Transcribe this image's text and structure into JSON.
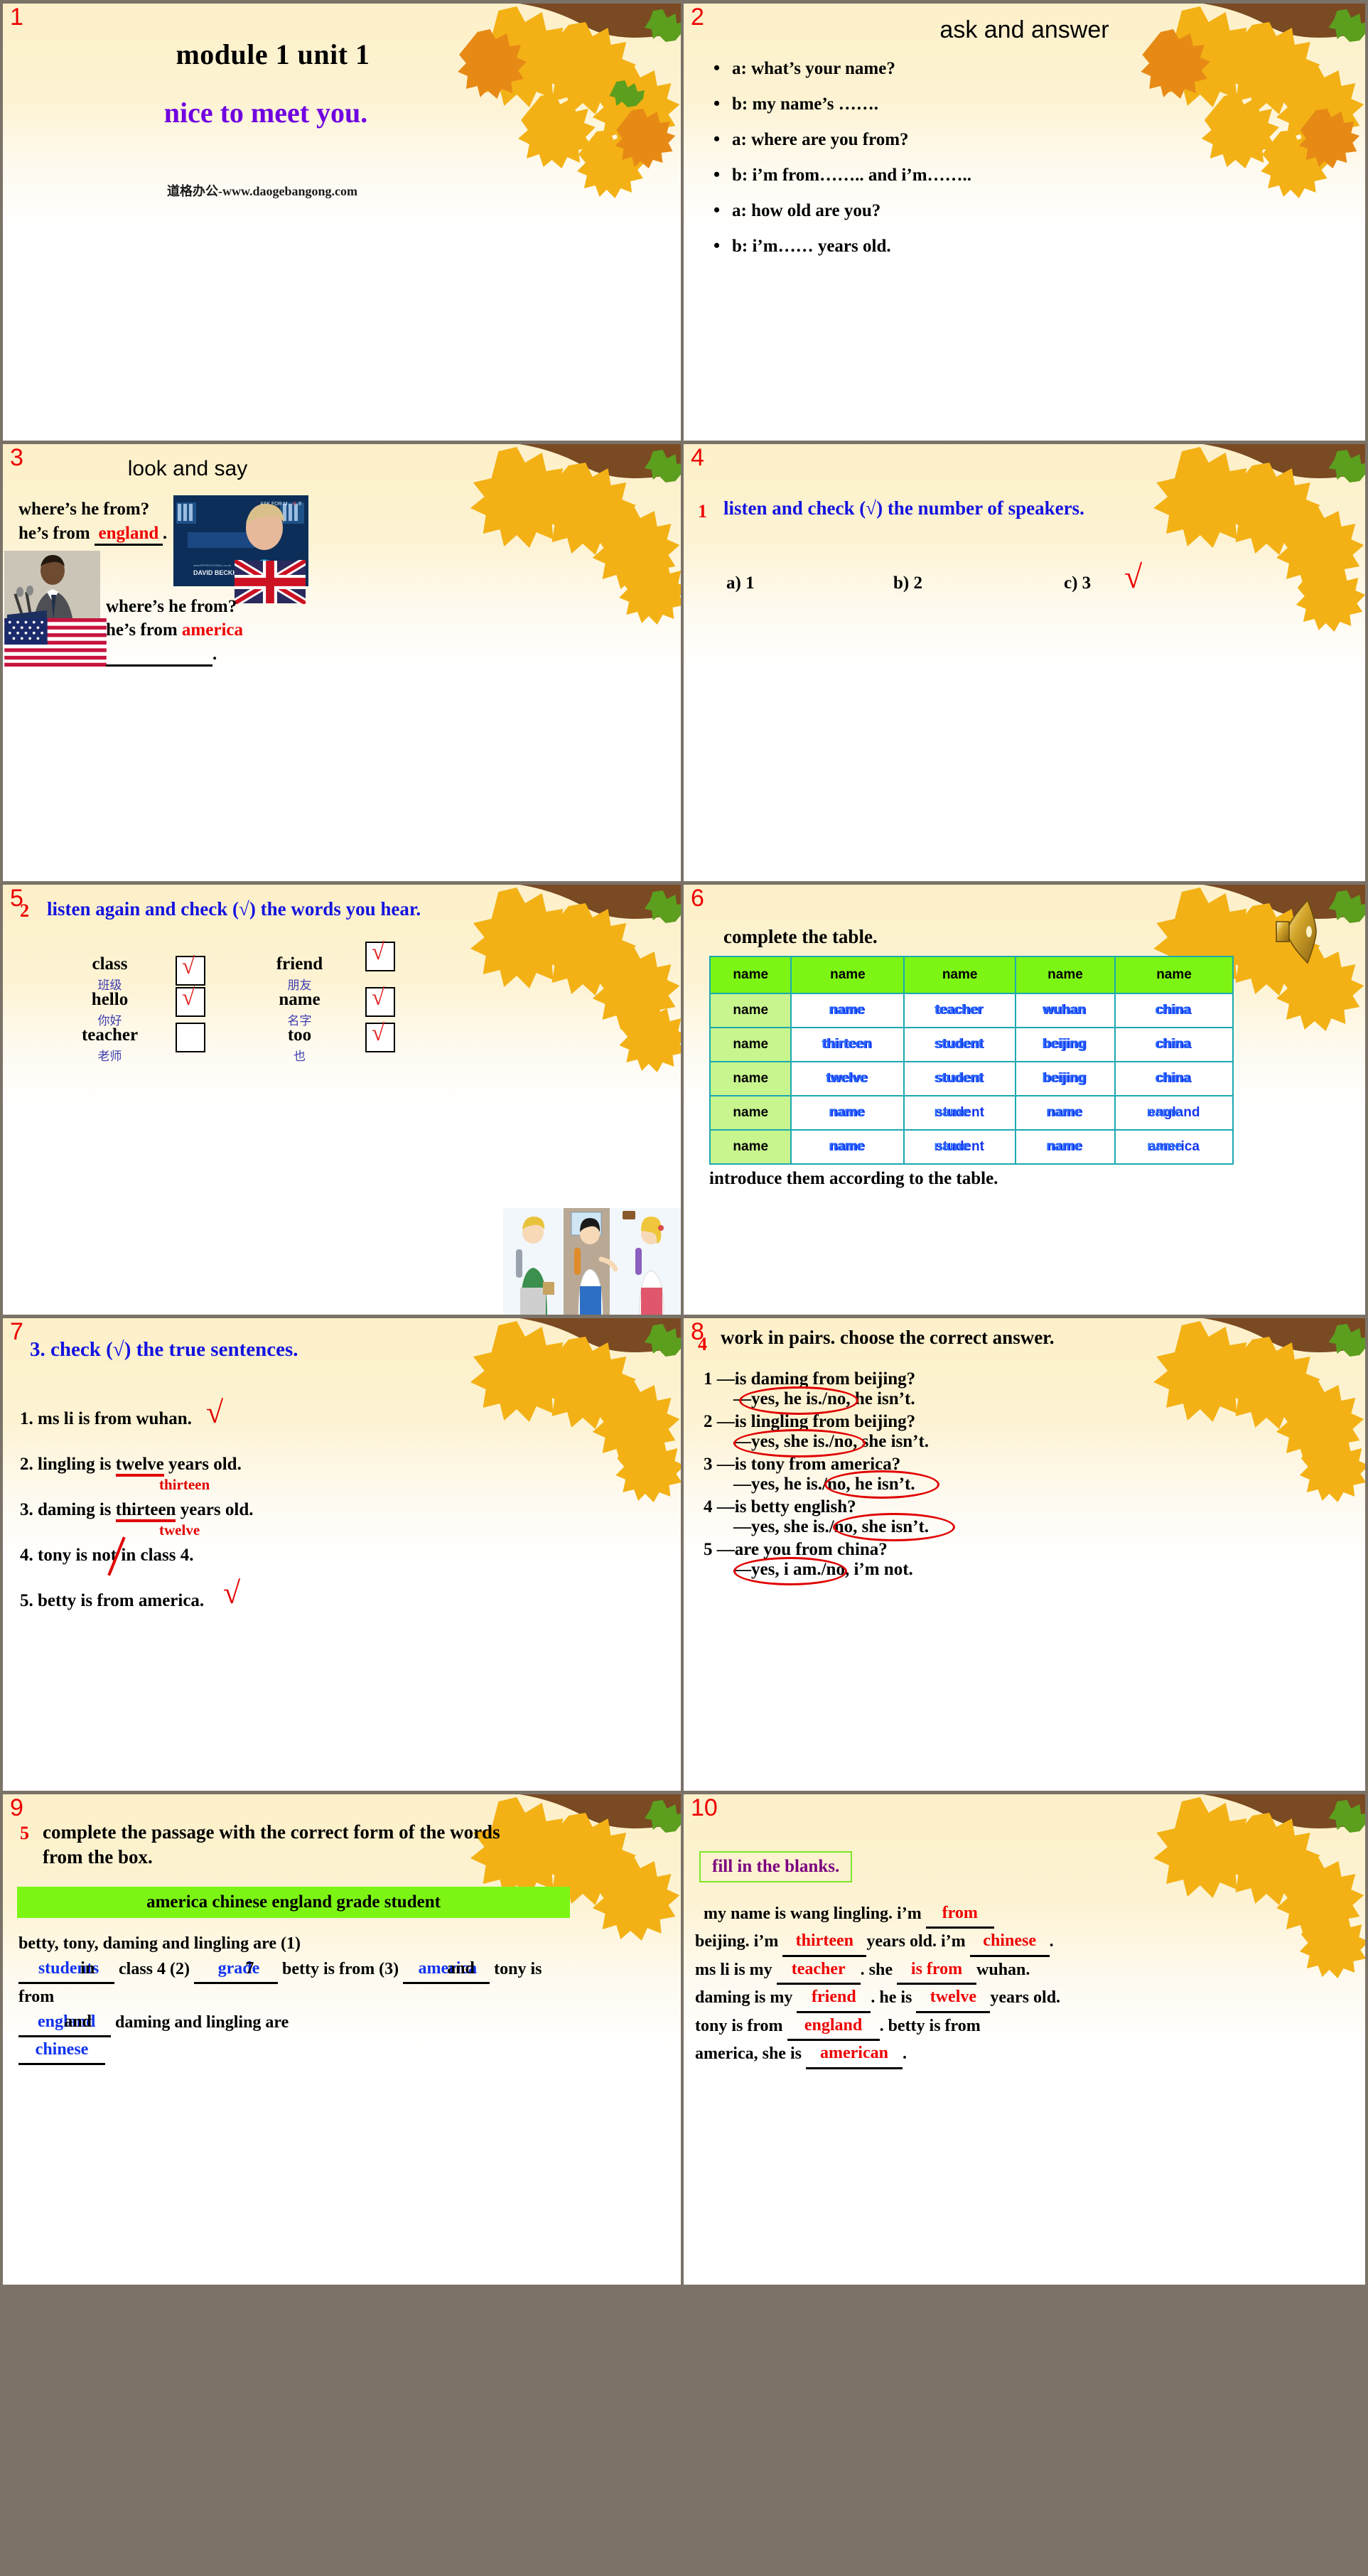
{
  "slides": [
    {
      "num": "1",
      "title": "module 1  unit 1",
      "subtitle": "nice to meet you.",
      "watermark": "道格办公-www.daogebangong.com"
    },
    {
      "num": "2",
      "title": "ask and answer",
      "items": [
        "a: what’s your name?",
        "b: my name’s …….",
        "a: where are you from?",
        "b: i’m from…….. and i’m……..",
        "a: how old are you?",
        "b: i’m…… years old."
      ]
    },
    {
      "num": "3",
      "title": "look and say",
      "q1": "where’s he from?",
      "a1_prefix": "he’s from",
      "a1_answer": "england",
      "a1_suffix": ".",
      "q2": "where’s he from?",
      "a2_prefix": "he’s from",
      "a2_answer": "america",
      "a2_suffix": ".",
      "photo1_caption": "DAVID BECKHAM",
      "photo1_tagline": "ASK FOR MORE",
      "flag1": "union-jack",
      "flag2": "stars-and-stripes"
    },
    {
      "num": "4",
      "tag": "1",
      "heading": "listen and check (√) the number of speakers.",
      "options": [
        "a) 1",
        "b) 2",
        "c) 3"
      ],
      "checked_option": "c) 3",
      "tick": "√"
    },
    {
      "num": "5",
      "tag": "2",
      "heading": "listen again and check (√) the words you hear.",
      "words": [
        {
          "en": "class",
          "cn": "班级",
          "checked": true
        },
        {
          "en": "friend",
          "cn": "朋友",
          "checked": true
        },
        {
          "en": "hello",
          "cn": "你好",
          "checked": true
        },
        {
          "en": "name",
          "cn": "名字",
          "checked": true
        },
        {
          "en": "teacher",
          "cn": "老师",
          "checked": false
        },
        {
          "en": "too",
          "cn": "也",
          "checked": true
        }
      ],
      "tick": "√"
    },
    {
      "num": "6",
      "heading": "complete the table.",
      "footer": "introduce them according to the table.",
      "speaker_icon": "speaker-icon",
      "table": {
        "headers": [
          "name",
          "name",
          "name",
          "name",
          "name"
        ],
        "rows": [
          {
            "col1": "name",
            "cells": [
              {
                "base": "name",
                "over": "name"
              },
              {
                "base": "teacher",
                "over": "teacher"
              },
              {
                "base": "wuhan",
                "over": "wuhan"
              },
              {
                "base": "china",
                "over": "china"
              }
            ]
          },
          {
            "col1": "name",
            "cells": [
              {
                "base": "thirteen",
                "over": "thirteen"
              },
              {
                "base": "student",
                "over": "student"
              },
              {
                "base": "beijing",
                "over": "beijing"
              },
              {
                "base": "china",
                "over": "china"
              }
            ]
          },
          {
            "col1": "name",
            "cells": [
              {
                "base": "twelve",
                "over": "twelve"
              },
              {
                "base": "student",
                "over": "student"
              },
              {
                "base": "beijing",
                "over": "beijing"
              },
              {
                "base": "china",
                "over": "china"
              }
            ]
          },
          {
            "col1": "name",
            "cells": [
              {
                "base": "name",
                "over": "name"
              },
              {
                "base": "student",
                "over": "name"
              },
              {
                "base": "name",
                "over": "name"
              },
              {
                "base": "england",
                "over": "name"
              }
            ]
          },
          {
            "col1": "name",
            "cells": [
              {
                "base": "name",
                "over": "name"
              },
              {
                "base": "student",
                "over": "name"
              },
              {
                "base": "name",
                "over": "name"
              },
              {
                "base": "america",
                "over": "name"
              }
            ]
          }
        ]
      }
    },
    {
      "num": "7",
      "heading": "3. check (√) the true sentences.",
      "sentences": [
        {
          "text": "1. ms li is from wuhan.",
          "mark": "tick"
        },
        {
          "text_pre": "2. lingling  is ",
          "underlined": "twelve",
          "text_post": " years old.",
          "correction": "thirteen"
        },
        {
          "text_pre": "3. daming is ",
          "underlined": "thirteen",
          "text_post": " years old.",
          "correction": "twelve"
        },
        {
          "text": "4. tony is not in class 4.",
          "mark": "strike"
        },
        {
          "text": "5. betty is from america.",
          "mark": "tick"
        }
      ],
      "tick": "√"
    },
    {
      "num": "8",
      "tag": "4",
      "heading": "work in pairs. choose the correct answer.",
      "pairs": [
        {
          "q": "1 —is daming from beijing?",
          "a_left": "—yes, he is.",
          "a_right": "/no, he isn’t.",
          "circled": "left"
        },
        {
          "q": "2 —is lingling from beijing?",
          "a_left": "—yes, she is.",
          "a_right": "/no, she isn’t.",
          "circled": "left"
        },
        {
          "q": "3 —is tony from america?",
          "a_left": "—yes, he is.",
          "a_right": "/no, he isn’t.",
          "circled": "right"
        },
        {
          "q": "4 —is betty english?",
          "a_left": "—yes, she is.",
          "a_right": "/no, she isn’t.",
          "circled": "right"
        },
        {
          "q": "5 —are you from china?",
          "a_left": "—yes, i am.",
          "a_right": "/no, i’m not.",
          "circled": "left"
        }
      ]
    },
    {
      "num": "9",
      "tag": "5",
      "heading": "complete the passage with the correct form of the words from the box.",
      "word_box": "america  chinese  england  grade  student",
      "passage_parts": {
        "p1": "betty, tony, daming and lingling are (1)",
        "ans1_a": "students",
        "ans1_b": "in",
        "p2": "class 4 (2)",
        "ans2_a": "grade",
        "ans2_b": "7",
        "p3": "betty is from (3)",
        "ans3_a": "america",
        "ans3_b": "and",
        "p4": "tony is from",
        "ans4_a": "england",
        "ans4_b": "and",
        "p5": "daming and lingling are",
        "ans5_a": "chinese"
      }
    },
    {
      "num": "10",
      "box_label": "fill in the blanks.",
      "passage": {
        "l1_pre": "my name is wang lingling. i’m",
        "l1_ans": "from",
        "l2_pre": "beijing. i’m",
        "l2_ans1": "thirteen",
        "l2_mid": "years old. i’m",
        "l2_ans2": "chinese",
        "l2_post": ".",
        "l3_pre": "ms li is my",
        "l3_ans1": "teacher",
        "l3_mid": ". she",
        "l3_ans2": "is from",
        "l3_post": "wuhan.",
        "l4_pre": "daming is my",
        "l4_ans1": "friend",
        "l4_mid": ". he is",
        "l4_ans2": "twelve",
        "l4_post": "years old.",
        "l5_pre": "tony is from",
        "l5_ans1": "england",
        "l5_post": ". betty is from",
        "l6_pre": "america, she is",
        "l6_ans1": "american",
        "l6_post": "."
      }
    }
  ]
}
